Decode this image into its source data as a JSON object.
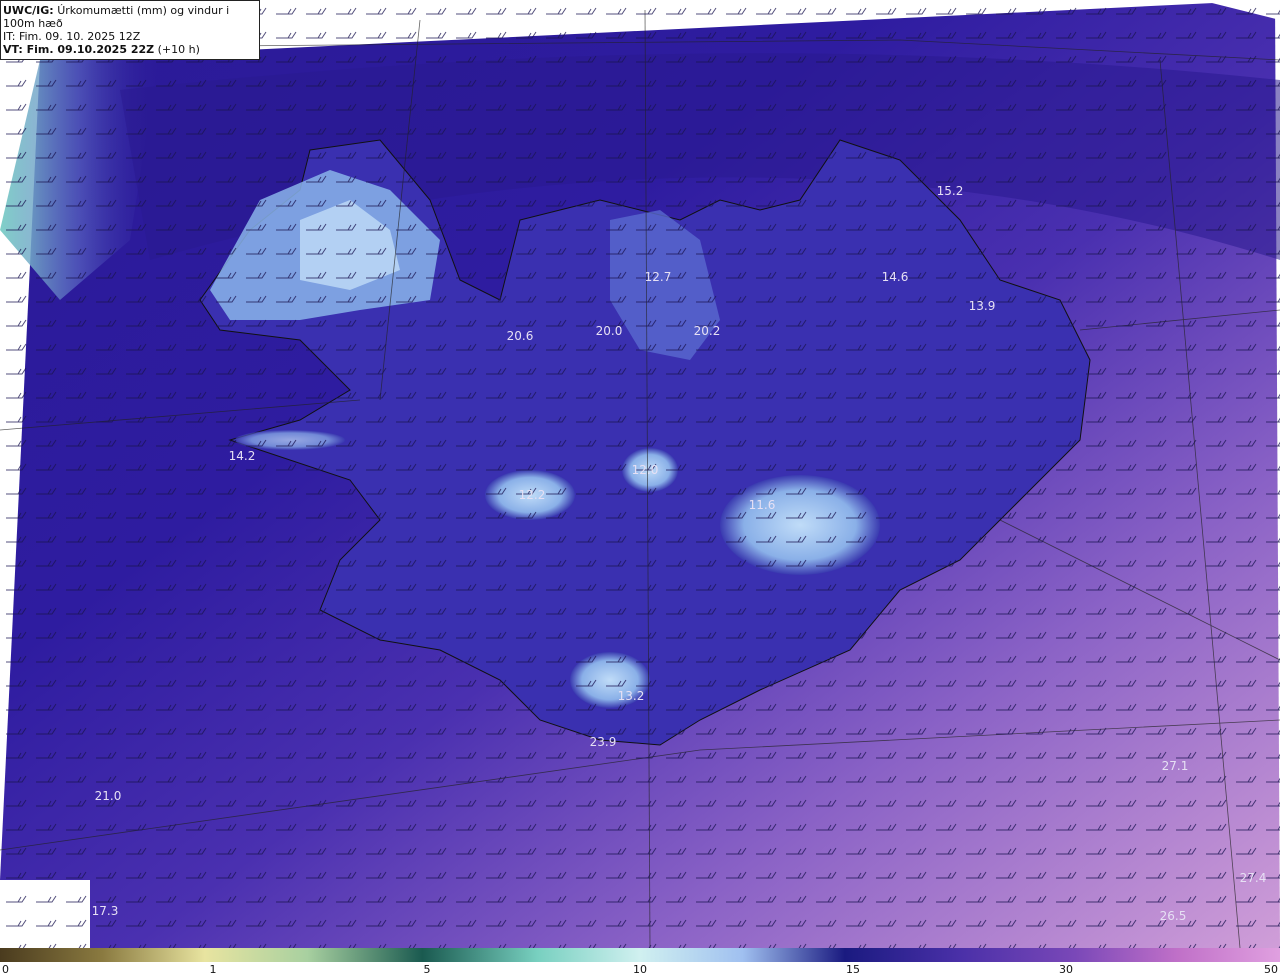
{
  "header": {
    "title_bold": "UWC/IG:",
    "title_rest": "Úrkomumætti (mm) og vindur i 100m hæð",
    "it_label": "IT:",
    "it_value": "Fim. 09. 10. 2025 12Z",
    "vt_label": "VT: Fim. 09.10.2025 22Z",
    "vt_offset": "(+10 h)"
  },
  "map": {
    "region": "Iceland",
    "ocean_gradient": [
      "#2a1a9a",
      "#3c2aa8",
      "#5a3cb8",
      "#8a62c6",
      "#b384d2",
      "#cc9ad8"
    ],
    "land_color": "#3a2fae",
    "glacier_color": "#a8c8f0",
    "coastline_color": "#111111",
    "wind_barb_color": "#222222",
    "labels": [
      {
        "text": "15.2"
      },
      {
        "text": "14.6"
      },
      {
        "text": "13.9"
      },
      {
        "text": "12.7"
      },
      {
        "text": "20.6"
      },
      {
        "text": "20.0"
      },
      {
        "text": "20.2"
      },
      {
        "text": "14.2"
      },
      {
        "text": "12.0"
      },
      {
        "text": "12.2"
      },
      {
        "text": "11.6"
      },
      {
        "text": "13.2"
      },
      {
        "text": "23.9"
      },
      {
        "text": "21.0"
      },
      {
        "text": "17.3"
      },
      {
        "text": "27.1"
      },
      {
        "text": "27.4"
      },
      {
        "text": "26.5"
      }
    ]
  },
  "colorbar": {
    "ticks": [
      "0",
      "1",
      "5",
      "10",
      "15",
      "30",
      "50"
    ],
    "colors": [
      "#4a3b1e",
      "#8a7a40",
      "#d8c878",
      "#e8e4a0",
      "#a8d0a0",
      "#3a8a70",
      "#1a5a50",
      "#78d0c0",
      "#d0f0f0",
      "#a0c0f0",
      "#3040b0",
      "#1a1a80",
      "#7a48b8",
      "#c070c8",
      "#d080d0",
      "#e0a0e0"
    ]
  }
}
